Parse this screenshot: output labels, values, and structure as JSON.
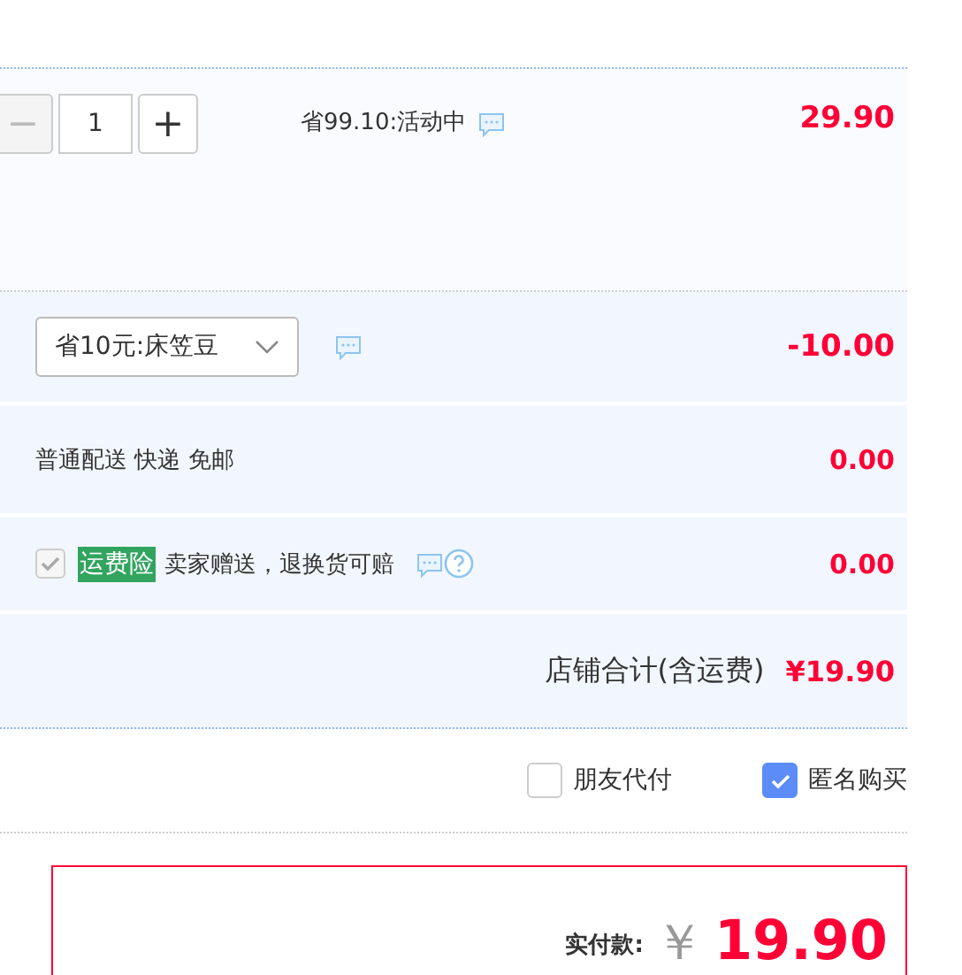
{
  "item": {
    "minus": "−",
    "quantity": "1",
    "plus": "+",
    "promo": "省99.10:活动中",
    "price": "29.90"
  },
  "coupon": {
    "value": "省10元:床笠豆",
    "amount": "-10.00"
  },
  "shipping": {
    "label": "普通配送 快递 免邮",
    "amount": "0.00"
  },
  "insurance": {
    "checked": true,
    "disabled": true,
    "tag": "运费险",
    "label": "卖家赠送，退换货可赔",
    "amount": "0.00"
  },
  "store_total": {
    "label": "店铺合计(含运费)",
    "amount": "¥19.90"
  },
  "options": [
    {
      "label": "朋友代付",
      "checked": false
    },
    {
      "label": "匿名购买",
      "checked": true
    }
  ],
  "payment": {
    "label": "实付款:",
    "currency": "￥",
    "amount": "19.90"
  }
}
